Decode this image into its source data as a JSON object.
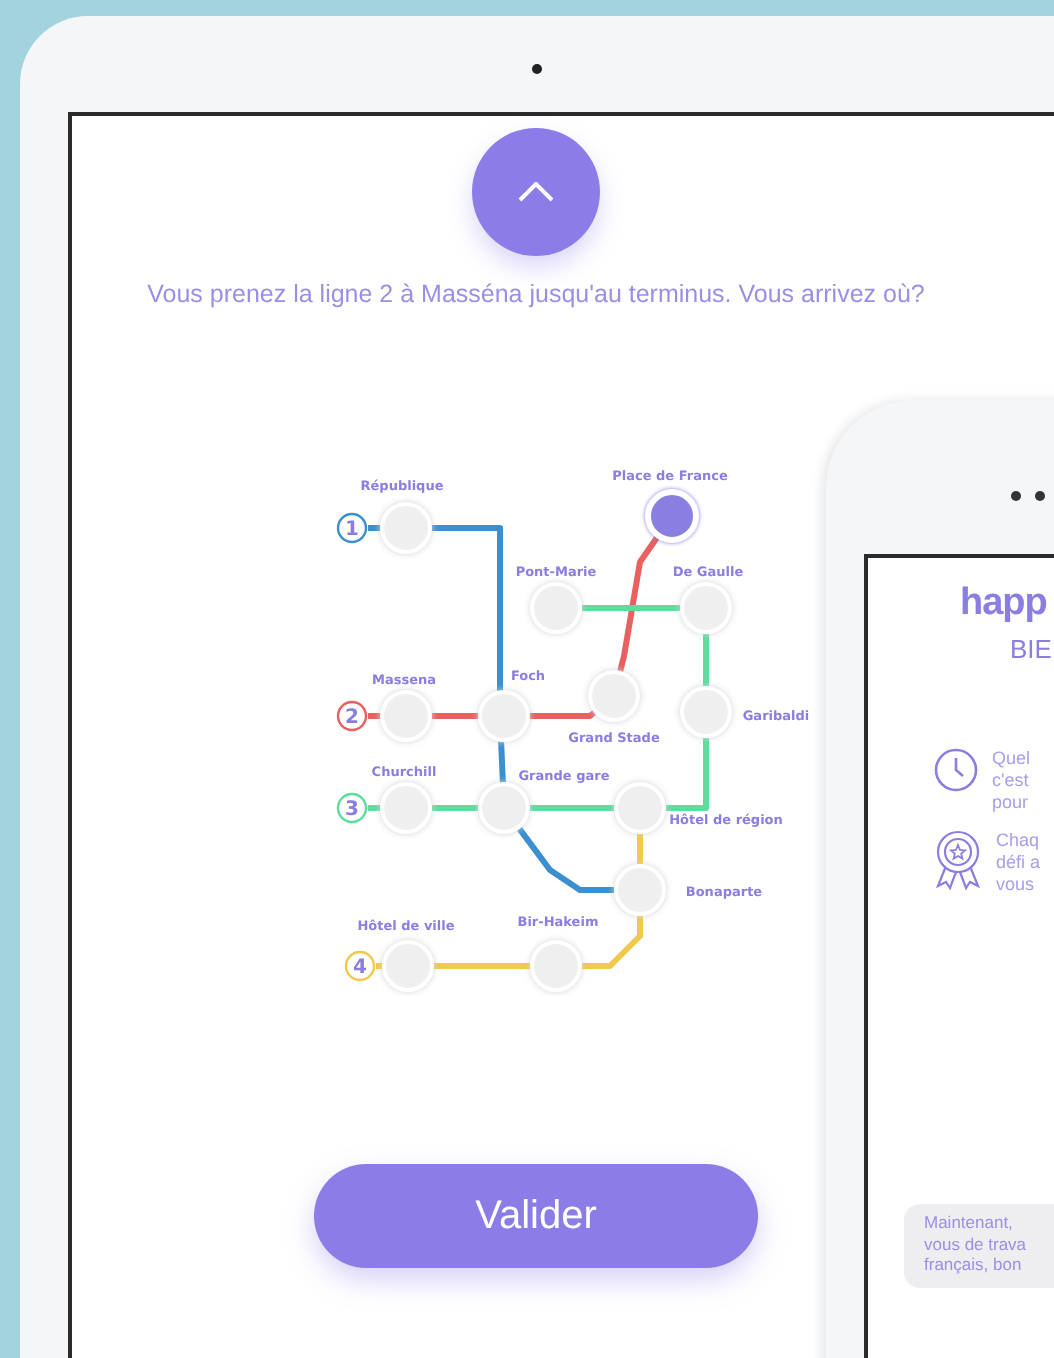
{
  "tablet_screen": {
    "question": "Vous prenez la ligne 2 à Masséna jusqu'au terminus. Vous arrivez où?",
    "lines": [
      {
        "number": "1",
        "color": "#3b8fcf"
      },
      {
        "number": "2",
        "color": "#e8605f"
      },
      {
        "number": "3",
        "color": "#5ddc9c"
      },
      {
        "number": "4",
        "color": "#f2c94c"
      }
    ],
    "stations": [
      {
        "name": "République",
        "selected": false
      },
      {
        "name": "Place de France",
        "selected": true
      },
      {
        "name": "Pont-Marie",
        "selected": false
      },
      {
        "name": "De Gaulle",
        "selected": false
      },
      {
        "name": "Massena",
        "selected": false
      },
      {
        "name": "Foch",
        "selected": false
      },
      {
        "name": "Grand Stade",
        "selected": false
      },
      {
        "name": "Garibaldi",
        "selected": false
      },
      {
        "name": "Churchill",
        "selected": false
      },
      {
        "name": "Grande gare",
        "selected": false
      },
      {
        "name": "Hôtel de région",
        "selected": false
      },
      {
        "name": "Bonaparte",
        "selected": false
      },
      {
        "name": "Hôtel de ville",
        "selected": false
      },
      {
        "name": "Bir-Hakeim",
        "selected": false
      }
    ],
    "submit_button": "Valider"
  },
  "phone_screen": {
    "logo": "happ",
    "subtitle": "BIE",
    "features": [
      {
        "kind": "clock",
        "text": "Quel\nc'est\npour"
      },
      {
        "kind": "award",
        "text": "Chaq\ndéfi a\nvous"
      }
    ],
    "message": "Maintenant,\nvous de trava\nfrançais, bon"
  }
}
